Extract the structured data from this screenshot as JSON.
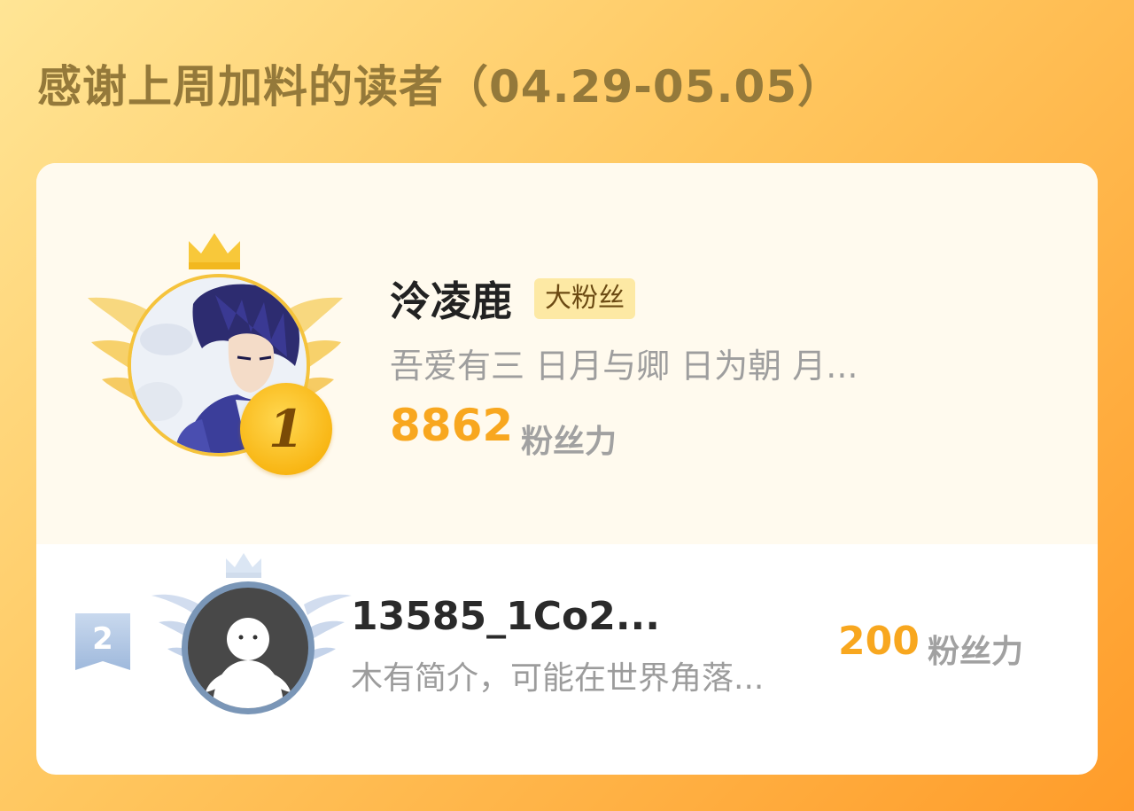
{
  "header": {
    "title": "感谢上周加料的读者（04.29-05.05）"
  },
  "leaderboard": {
    "entries": [
      {
        "rank": "1",
        "name": "泠凌鹿",
        "tag": "大粉丝",
        "bio": "吾爱有三 日月与卿 日为朝 月...",
        "score": "8862",
        "unit": "粉丝力",
        "avatar_icon": "anime-character-avatar",
        "rank_color": "#f8b410"
      },
      {
        "rank": "2",
        "name": "13585_1Co2...",
        "bio": "木有简介，可能在世界角落...",
        "score": "200",
        "unit": "粉丝力",
        "avatar_icon": "default-user-avatar",
        "rank_color": "#7a96b7"
      }
    ]
  },
  "colors": {
    "title": "#94793a",
    "score": "#f8a71f",
    "gold": "#f5c33c",
    "silver": "#7a96b7"
  }
}
